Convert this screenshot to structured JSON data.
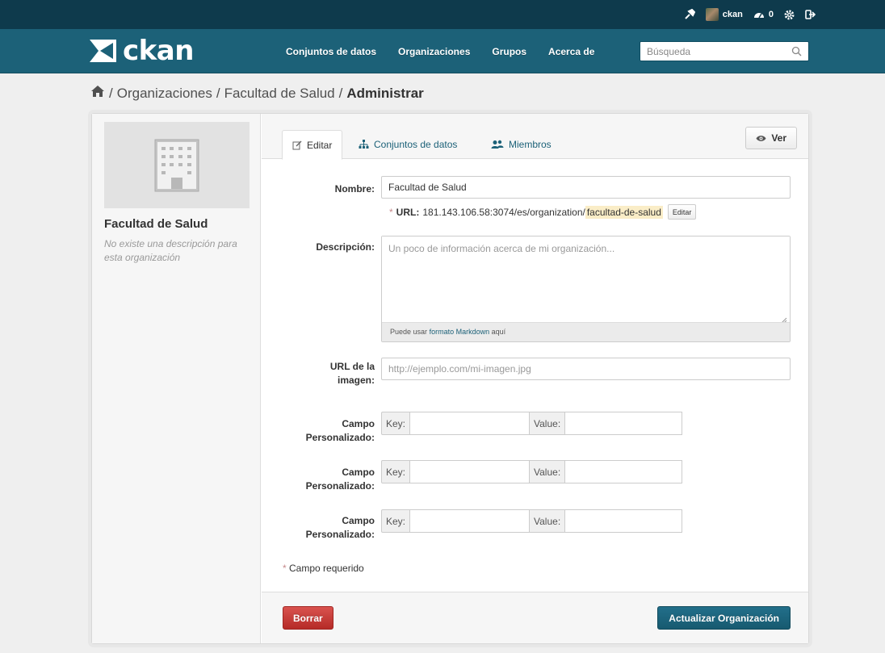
{
  "account": {
    "username": "ckan",
    "activity_count": "0",
    "icons": [
      "sysadmin-hammer-icon",
      "dashboard-icon",
      "settings-gear-icon",
      "logout-icon"
    ]
  },
  "masthead": {
    "logo_text": "ckan",
    "nav": [
      "Conjuntos de datos",
      "Organizaciones",
      "Grupos",
      "Acerca de"
    ],
    "search_placeholder": "Búsqueda"
  },
  "breadcrumb": {
    "items": [
      "Organizaciones",
      "Facultad de Salud"
    ],
    "active": "Administrar"
  },
  "sidebar": {
    "title": "Facultad de Salud",
    "description": "No existe una descripción para esta organización"
  },
  "tabs": {
    "items": [
      "Editar",
      "Conjuntos de datos",
      "Miembros"
    ],
    "view_button": "Ver"
  },
  "form": {
    "name_label": "Nombre:",
    "name_value": "Facultad de Salud",
    "url_prefix_label": "URL:",
    "url_base": "181.143.106.58:3074/es/organization/",
    "url_slug": "facultad-de-salud",
    "url_edit_button": "Editar",
    "description_label": "Descripción:",
    "description_placeholder": "Un poco de información acerca de mi organización...",
    "markdown_note_prefix": "Puede usar",
    "markdown_link": "formato Markdown",
    "markdown_note_suffix": "aquí",
    "image_url_label": "URL de la imagen:",
    "image_url_placeholder": "http://ejemplo.com/mi-imagen.jpg",
    "custom_field_label": "Campo Personalizado:",
    "key_label": "Key:",
    "value_label": "Value:",
    "required_note": "Campo requerido",
    "required_marker": "*"
  },
  "actions": {
    "delete_button": "Borrar",
    "update_button": "Actualizar Organización"
  },
  "colors": {
    "account_bar": "#0e3a4c",
    "masthead": "#1c6178",
    "delete": "#d9534f",
    "primary_button": "#1c6178",
    "slug_highlight": "#faedc7"
  }
}
